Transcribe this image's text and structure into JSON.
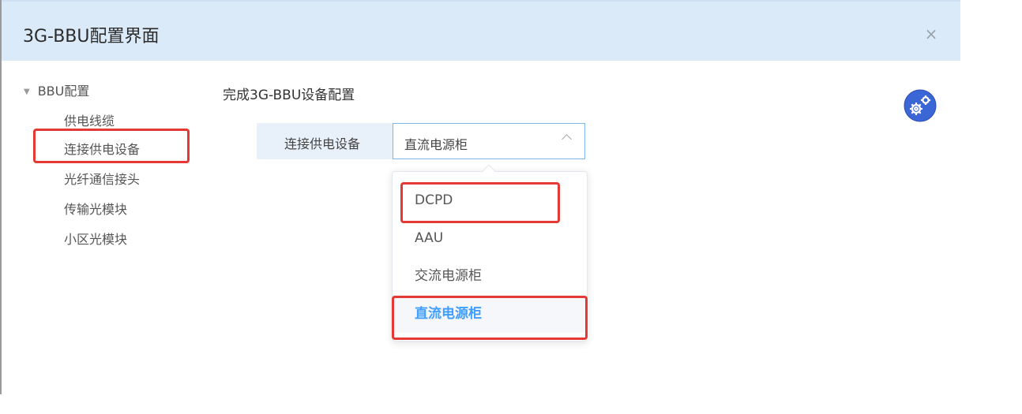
{
  "dialog": {
    "title": "3G-BBU配置界面",
    "close_label": "×"
  },
  "tree": {
    "root_label": "BBU配置",
    "items": [
      {
        "label": "供电线缆"
      },
      {
        "label": "连接供电设备"
      },
      {
        "label": "光纤通信接头"
      },
      {
        "label": "传输光模块"
      },
      {
        "label": "小区光模块"
      }
    ]
  },
  "main": {
    "heading": "完成3G-BBU设备配置",
    "field_label": "连接供电设备",
    "select_value": "直流电源柜",
    "options": [
      {
        "label": "DCPD"
      },
      {
        "label": "AAU"
      },
      {
        "label": "交流电源柜"
      },
      {
        "label": "直流电源柜"
      }
    ]
  },
  "colors": {
    "header_bg": "#dbeaf8",
    "highlight_box": "#e53935",
    "selected_option": "#409eff",
    "gear_badge": "#3b66d6"
  },
  "icons": {
    "close": "close-icon",
    "caret": "caret-down-icon",
    "chevron": "chevron-up-icon",
    "settings": "gear-icon"
  }
}
